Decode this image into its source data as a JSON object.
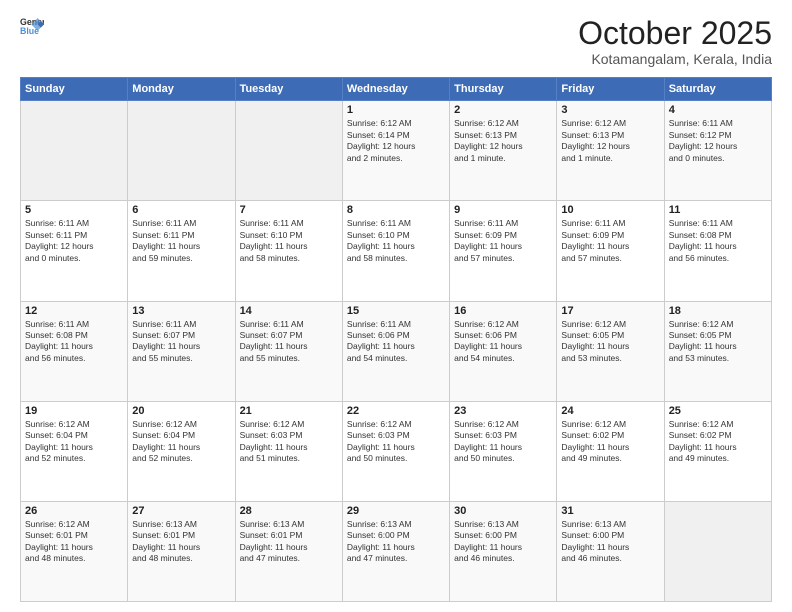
{
  "header": {
    "logo_general": "General",
    "logo_blue": "Blue",
    "month_title": "October 2025",
    "location": "Kotamangalam, Kerala, India"
  },
  "weekdays": [
    "Sunday",
    "Monday",
    "Tuesday",
    "Wednesday",
    "Thursday",
    "Friday",
    "Saturday"
  ],
  "weeks": [
    [
      {
        "day": "",
        "info": ""
      },
      {
        "day": "",
        "info": ""
      },
      {
        "day": "",
        "info": ""
      },
      {
        "day": "1",
        "info": "Sunrise: 6:12 AM\nSunset: 6:14 PM\nDaylight: 12 hours\nand 2 minutes."
      },
      {
        "day": "2",
        "info": "Sunrise: 6:12 AM\nSunset: 6:13 PM\nDaylight: 12 hours\nand 1 minute."
      },
      {
        "day": "3",
        "info": "Sunrise: 6:12 AM\nSunset: 6:13 PM\nDaylight: 12 hours\nand 1 minute."
      },
      {
        "day": "4",
        "info": "Sunrise: 6:11 AM\nSunset: 6:12 PM\nDaylight: 12 hours\nand 0 minutes."
      }
    ],
    [
      {
        "day": "5",
        "info": "Sunrise: 6:11 AM\nSunset: 6:11 PM\nDaylight: 12 hours\nand 0 minutes."
      },
      {
        "day": "6",
        "info": "Sunrise: 6:11 AM\nSunset: 6:11 PM\nDaylight: 11 hours\nand 59 minutes."
      },
      {
        "day": "7",
        "info": "Sunrise: 6:11 AM\nSunset: 6:10 PM\nDaylight: 11 hours\nand 58 minutes."
      },
      {
        "day": "8",
        "info": "Sunrise: 6:11 AM\nSunset: 6:10 PM\nDaylight: 11 hours\nand 58 minutes."
      },
      {
        "day": "9",
        "info": "Sunrise: 6:11 AM\nSunset: 6:09 PM\nDaylight: 11 hours\nand 57 minutes."
      },
      {
        "day": "10",
        "info": "Sunrise: 6:11 AM\nSunset: 6:09 PM\nDaylight: 11 hours\nand 57 minutes."
      },
      {
        "day": "11",
        "info": "Sunrise: 6:11 AM\nSunset: 6:08 PM\nDaylight: 11 hours\nand 56 minutes."
      }
    ],
    [
      {
        "day": "12",
        "info": "Sunrise: 6:11 AM\nSunset: 6:08 PM\nDaylight: 11 hours\nand 56 minutes."
      },
      {
        "day": "13",
        "info": "Sunrise: 6:11 AM\nSunset: 6:07 PM\nDaylight: 11 hours\nand 55 minutes."
      },
      {
        "day": "14",
        "info": "Sunrise: 6:11 AM\nSunset: 6:07 PM\nDaylight: 11 hours\nand 55 minutes."
      },
      {
        "day": "15",
        "info": "Sunrise: 6:11 AM\nSunset: 6:06 PM\nDaylight: 11 hours\nand 54 minutes."
      },
      {
        "day": "16",
        "info": "Sunrise: 6:12 AM\nSunset: 6:06 PM\nDaylight: 11 hours\nand 54 minutes."
      },
      {
        "day": "17",
        "info": "Sunrise: 6:12 AM\nSunset: 6:05 PM\nDaylight: 11 hours\nand 53 minutes."
      },
      {
        "day": "18",
        "info": "Sunrise: 6:12 AM\nSunset: 6:05 PM\nDaylight: 11 hours\nand 53 minutes."
      }
    ],
    [
      {
        "day": "19",
        "info": "Sunrise: 6:12 AM\nSunset: 6:04 PM\nDaylight: 11 hours\nand 52 minutes."
      },
      {
        "day": "20",
        "info": "Sunrise: 6:12 AM\nSunset: 6:04 PM\nDaylight: 11 hours\nand 52 minutes."
      },
      {
        "day": "21",
        "info": "Sunrise: 6:12 AM\nSunset: 6:03 PM\nDaylight: 11 hours\nand 51 minutes."
      },
      {
        "day": "22",
        "info": "Sunrise: 6:12 AM\nSunset: 6:03 PM\nDaylight: 11 hours\nand 50 minutes."
      },
      {
        "day": "23",
        "info": "Sunrise: 6:12 AM\nSunset: 6:03 PM\nDaylight: 11 hours\nand 50 minutes."
      },
      {
        "day": "24",
        "info": "Sunrise: 6:12 AM\nSunset: 6:02 PM\nDaylight: 11 hours\nand 49 minutes."
      },
      {
        "day": "25",
        "info": "Sunrise: 6:12 AM\nSunset: 6:02 PM\nDaylight: 11 hours\nand 49 minutes."
      }
    ],
    [
      {
        "day": "26",
        "info": "Sunrise: 6:12 AM\nSunset: 6:01 PM\nDaylight: 11 hours\nand 48 minutes."
      },
      {
        "day": "27",
        "info": "Sunrise: 6:13 AM\nSunset: 6:01 PM\nDaylight: 11 hours\nand 48 minutes."
      },
      {
        "day": "28",
        "info": "Sunrise: 6:13 AM\nSunset: 6:01 PM\nDaylight: 11 hours\nand 47 minutes."
      },
      {
        "day": "29",
        "info": "Sunrise: 6:13 AM\nSunset: 6:00 PM\nDaylight: 11 hours\nand 47 minutes."
      },
      {
        "day": "30",
        "info": "Sunrise: 6:13 AM\nSunset: 6:00 PM\nDaylight: 11 hours\nand 46 minutes."
      },
      {
        "day": "31",
        "info": "Sunrise: 6:13 AM\nSunset: 6:00 PM\nDaylight: 11 hours\nand 46 minutes."
      },
      {
        "day": "",
        "info": ""
      }
    ]
  ]
}
